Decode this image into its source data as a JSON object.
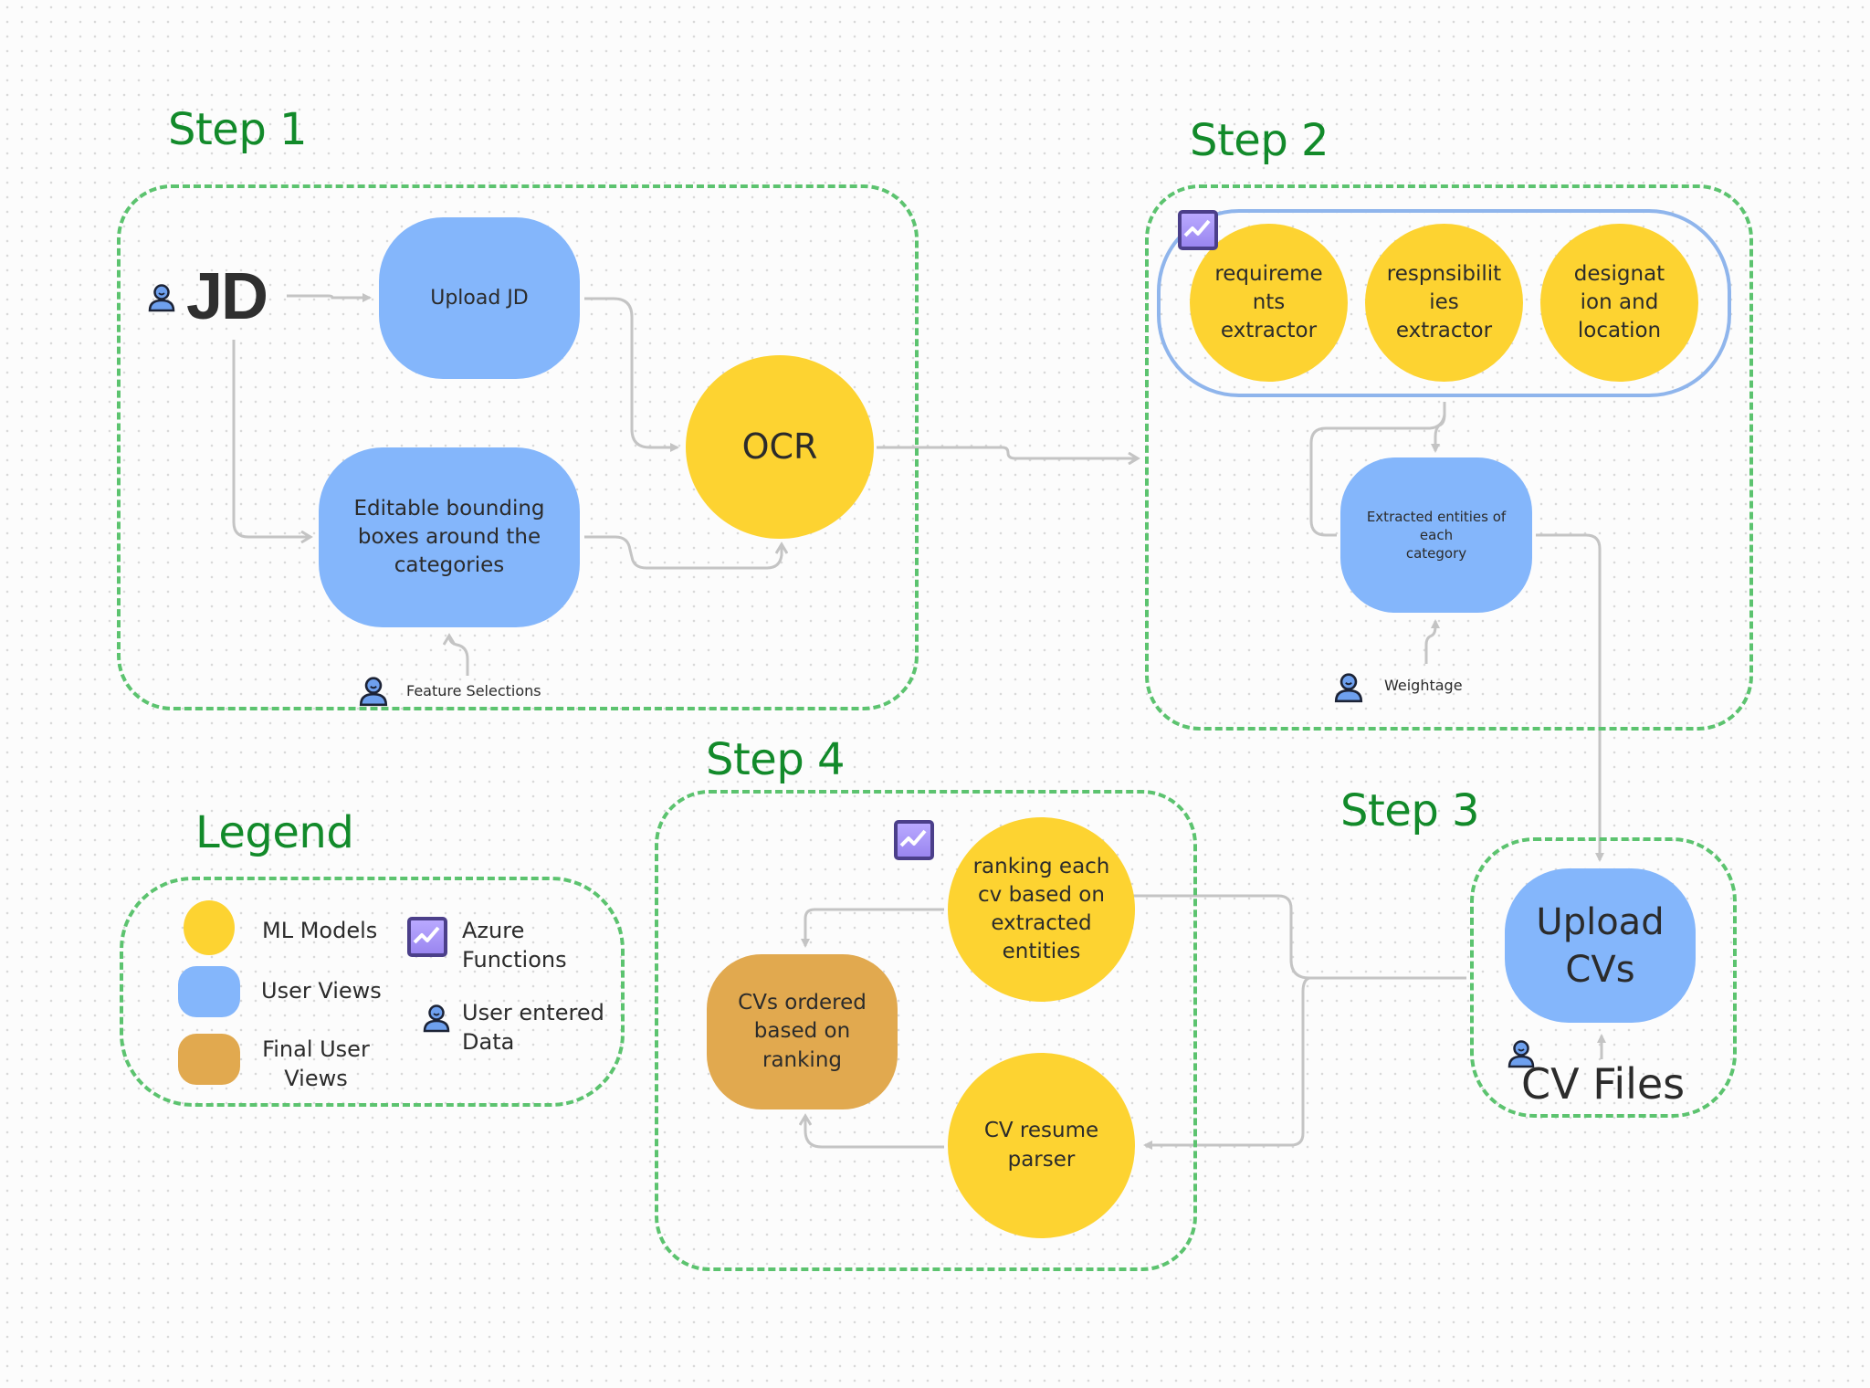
{
  "colors": {
    "ml_model": "#fdd331",
    "user_view": "#84b6fb",
    "final_user_view": "#e1a94f",
    "group_border": "#5cc36f",
    "step_label": "#128a2a",
    "connector": "#c4c4c4",
    "capsule_border": "#8fb5ec"
  },
  "step1": {
    "label": "Step 1",
    "jd_label": "JD",
    "upload_jd": "Upload JD",
    "editable_boxes": "Editable bounding\nboxes around the\ncategories",
    "ocr": "OCR",
    "feature_selections": "Feature Selections"
  },
  "step2": {
    "label": "Step 2",
    "extractors": [
      "requireme\nnts\nextractor",
      "respnsibilit\nies\nextractor",
      "designat\nion and\nlocation"
    ],
    "extracted_entities": "Extracted entities of\neach\ncategory",
    "weightage": "Weightage"
  },
  "step3": {
    "label": "Step 3",
    "upload_cvs": "Upload\nCVs",
    "cv_files": "CV Files"
  },
  "step4": {
    "label": "Step 4",
    "ranking": "ranking each\ncv based on\nextracted\nentities",
    "cvs_ordered": "CVs ordered\nbased on\nranking",
    "cv_parser": "CV resume\nparser"
  },
  "legend": {
    "label": "Legend",
    "items": [
      {
        "icon": "ml-model-swatch",
        "label": "ML Models"
      },
      {
        "icon": "user-view-swatch",
        "label": "User Views"
      },
      {
        "icon": "final-user-view-swatch",
        "label": "Final User\nViews"
      },
      {
        "icon": "azure-function-icon",
        "label": "Azure\nFunctions"
      },
      {
        "icon": "person-icon",
        "label": "User entered\nData"
      }
    ]
  }
}
